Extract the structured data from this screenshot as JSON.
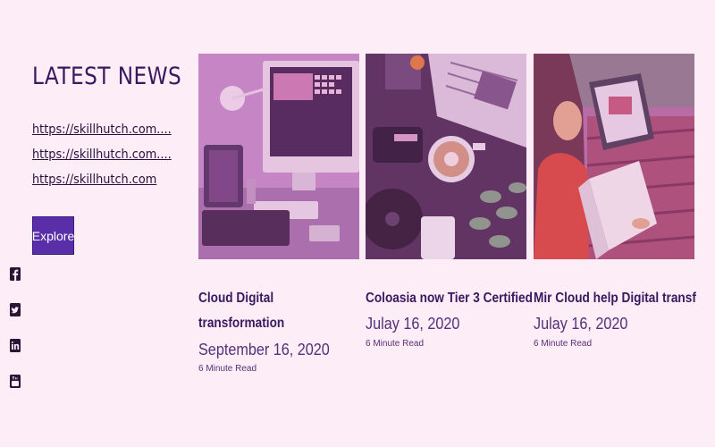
{
  "section_title": "LATEST NEWS",
  "links": [
    "https://skillhutch.com....",
    "https://skillhutch.com....",
    "https://skillhutch.com"
  ],
  "explore_label": "Explore",
  "social_icons": [
    "facebook-icon",
    "twitter-icon",
    "linkedin-icon",
    "youtube-icon"
  ],
  "cards": [
    {
      "title_line1": "Cloud Digital",
      "title_line2": "transformation",
      "date": "September 16, 2020",
      "read_time": "6 Minute Read"
    },
    {
      "title_line1": "Coloasia now Tier 3 Certified",
      "title_line2": "",
      "date": "Julay 16, 2020",
      "read_time": "6 Minute Read"
    },
    {
      "title_line1": "Mir Cloud help Digital transf",
      "title_line2": "",
      "date": "Julay 16, 2020",
      "read_time": "6 Minute Read"
    }
  ],
  "colors": {
    "background": "#fcedf6",
    "accent": "#5a2ea8",
    "text": "#3b1960"
  }
}
